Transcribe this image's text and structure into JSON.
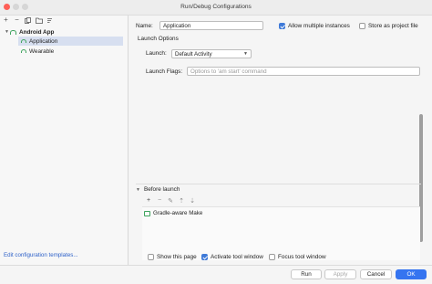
{
  "window": {
    "title": "Run/Debug Configurations"
  },
  "left_panel": {
    "toolbar_icons": [
      "add-icon",
      "remove-icon",
      "copy-icon",
      "folder-icon",
      "sort-icon"
    ],
    "tree": {
      "group": "Android App",
      "items": [
        {
          "label": "Application",
          "selected": true
        },
        {
          "label": "Wearable",
          "selected": false
        }
      ]
    },
    "edit_templates_link": "Edit configuration templates..."
  },
  "config": {
    "name_label": "Name:",
    "name_value": "Application",
    "allow_multiple_label": "Allow multiple instances",
    "allow_multiple_checked": true,
    "store_project_label": "Store as project file",
    "store_project_checked": false,
    "launch_options_header": "Launch Options",
    "launch_label": "Launch:",
    "launch_value": "Default Activity",
    "launch_flags_label": "Launch Flags:",
    "launch_flags_placeholder": "Options to 'am start' command"
  },
  "before_launch": {
    "header": "Before launch",
    "toolbar_icons": [
      "add-icon",
      "remove-icon",
      "edit-icon",
      "move-up-icon",
      "move-down-icon"
    ],
    "items": [
      "Gradle-aware Make"
    ]
  },
  "options": {
    "show_page_label": "Show this page",
    "show_page_checked": false,
    "activate_tool_label": "Activate tool window",
    "activate_tool_checked": true,
    "focus_tool_label": "Focus tool window",
    "focus_tool_checked": false
  },
  "buttons": {
    "run": "Run",
    "apply": "Apply",
    "cancel": "Cancel",
    "ok": "OK"
  },
  "colors": {
    "accent": "#3574f0",
    "selection": "#d7dff0",
    "link": "#2f62c9"
  }
}
